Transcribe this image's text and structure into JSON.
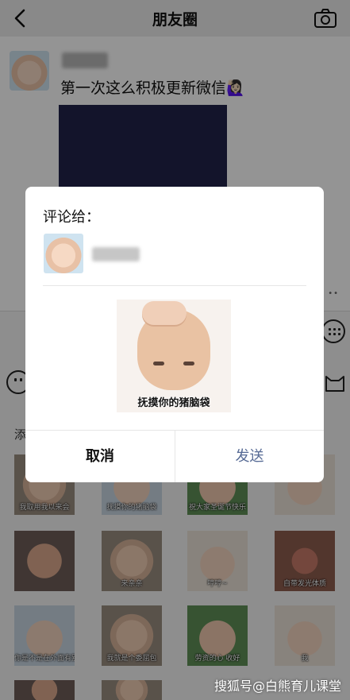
{
  "nav": {
    "title": "朋友圈"
  },
  "post": {
    "text": "第一次这么积极更新微信🙋🏻‍♀️"
  },
  "tray": {
    "label": "添",
    "stickers": [
      {
        "caption": "我取用我以来会"
      },
      {
        "caption": "抚摸你的猪脑袋"
      },
      {
        "caption": "祝大家圣诞节快乐"
      },
      {
        "caption": ""
      },
      {
        "caption": ""
      },
      {
        "caption": "来亲亲"
      },
      {
        "caption": "哼哼~"
      },
      {
        "caption": "自带发光体质"
      },
      {
        "caption": "你是不是在外面有别的小猪啊"
      },
      {
        "caption": "我就是个委屈包"
      },
      {
        "caption": "劳资的心 收好"
      },
      {
        "caption": "我"
      }
    ]
  },
  "dialog": {
    "title": "评论给：",
    "sticker_caption": "抚摸你的猪脑袋",
    "cancel_label": "取消",
    "send_label": "发送"
  },
  "watermark": "搜狐号@白熊育儿课堂",
  "colors": {
    "link": "#576b95",
    "overlay": "rgba(0,0,0,0.42)"
  }
}
